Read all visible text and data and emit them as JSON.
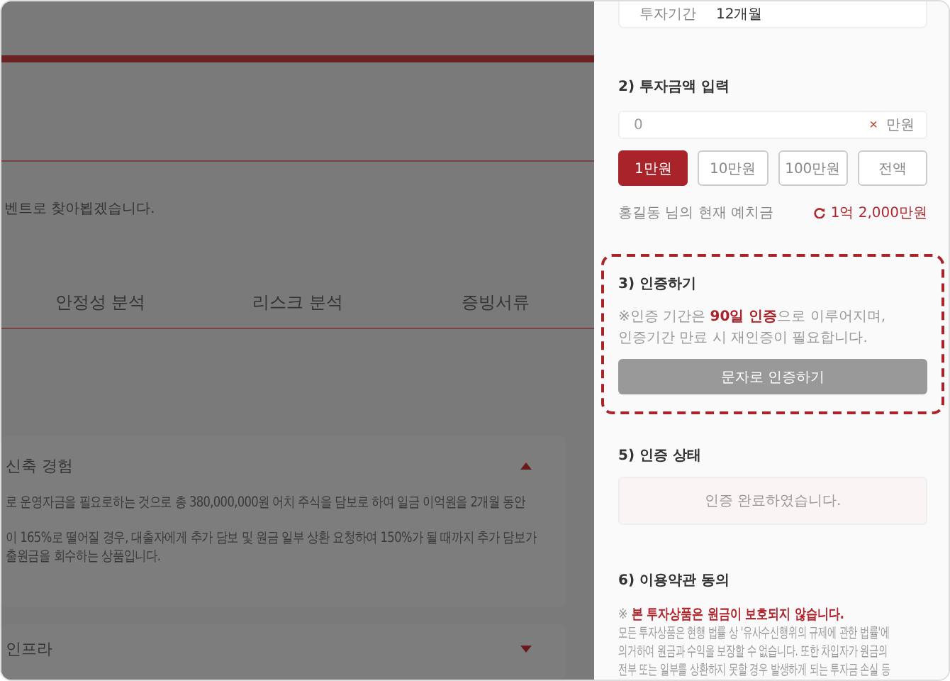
{
  "background_page": {
    "intro_text": "벤트로 찾아뵙겠습니다.",
    "tabs": [
      "안정성 분석",
      "리스크 분석",
      "증빙서류"
    ],
    "sections": [
      {
        "title": "신축 경험",
        "expanded": true,
        "paragraphs": [
          "로 운영자금을 필요로하는 것으로 총 380,000,000원 어치 주식을 담보로 하여 일금 이억원을 2개월 동안",
          "이 165%로 떨어질 경우, 대출자에게 추가 담보 및 원금 일부 상환 요청하여 150%가 될 때까지 추가 담보가\n출원금을 회수하는 상품입니다."
        ]
      },
      {
        "title": "인프라",
        "expanded": false
      }
    ]
  },
  "panel": {
    "period": {
      "label": "투자기간",
      "value": "12개월"
    },
    "amount": {
      "heading": "2) 투자금액 입력",
      "placeholder": "0",
      "unit": "만원",
      "clear": "×",
      "quick_buttons": [
        {
          "label": "1만원",
          "selected": true
        },
        {
          "label": "10만원",
          "selected": false
        },
        {
          "label": "100만원",
          "selected": false
        },
        {
          "label": "전액",
          "selected": false
        }
      ],
      "deposit_label": "홍길동 님의 현재 예치금",
      "deposit_value": "1억 2,000만원"
    },
    "verify": {
      "heading": "3) 인증하기",
      "note_lines": [
        "※인증 기간은 **90일 인증**으로 이루어지며,",
        "인증기간 만료 시 재인증이 필요합니다."
      ],
      "button": "문자로 인증하기",
      "button_disabled": true
    },
    "status": {
      "heading": "5) 인증 상태",
      "message": "인증 완료하였습니다."
    },
    "terms": {
      "heading": "6) 이용약관 동의",
      "warning": "※ **본 투자상품은 원금이 보호되지 않습니다.**",
      "body_lines": [
        "모든 투자상품은 현행 법률 상 '유사수신행위의 규제에 관한 법률'에",
        "의거하여 원금과 수익을 보장할 수 없습니다. 또한 차입자가 원금의",
        "전부 또는 일부를 상환하지 못할 경우 발생하게 되는 투자금 손실 등"
      ]
    }
  }
}
